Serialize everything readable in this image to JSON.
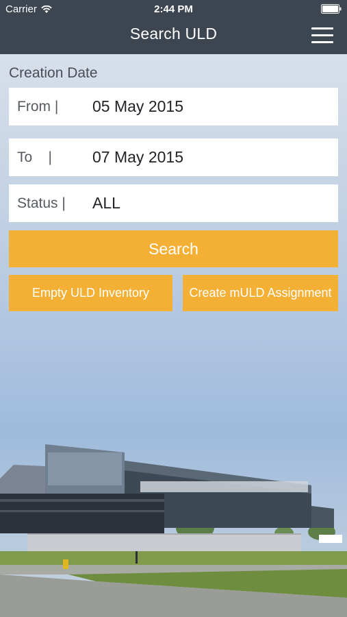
{
  "status_bar": {
    "carrier": "Carrier",
    "time": "2:44 PM",
    "icons": [
      "wifi-icon",
      "battery-icon"
    ]
  },
  "header": {
    "title": "Search ULD",
    "menu_icon": "hamburger-menu-icon"
  },
  "form": {
    "section_label": "Creation Date",
    "from": {
      "label": "From |",
      "value": "05 May 2015"
    },
    "to": {
      "label": "To    |",
      "value": "07 May 2015"
    },
    "status": {
      "label": "Status |",
      "value": "ALL"
    }
  },
  "buttons": {
    "search": "Search",
    "empty_inventory": "Empty ULD Inventory",
    "create_assignment": "Create mULD Assignment"
  },
  "colors": {
    "header_bg": "#3d4550",
    "accent": "#f4b035",
    "field_bg": "#ffffff"
  }
}
